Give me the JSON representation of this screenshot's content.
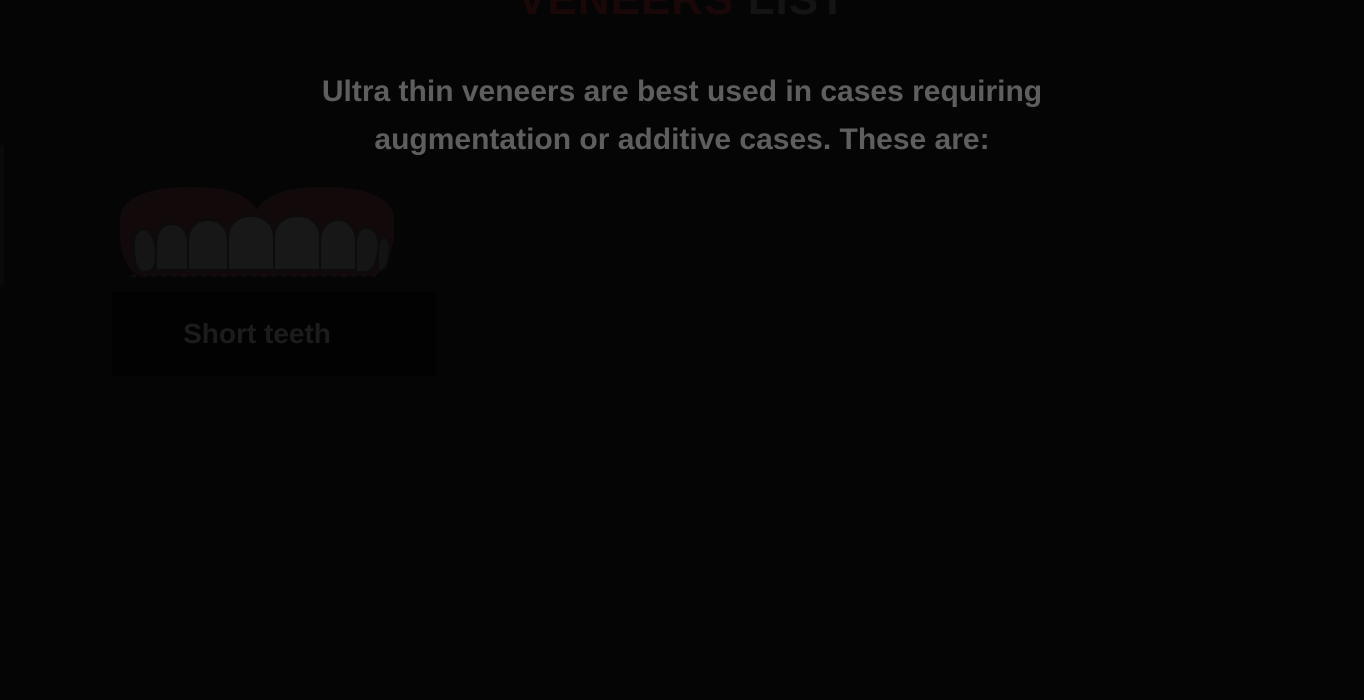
{
  "heading": {
    "accent_text": "VENEERS",
    "rest_text": "LIST"
  },
  "intro": {
    "line1": "Ultra thin veneers are best used in cases requiring",
    "line2": "augmentation or additive cases. These are:"
  },
  "cards": [
    {
      "label": "Short teeth",
      "icon": "teeth-icon"
    }
  ],
  "colors": {
    "background": "#050505",
    "intro_text": "#5e5e5e",
    "card_label_text": "#1c1c1c",
    "card_label_bg": "#020202",
    "gum": "#120a0a",
    "tooth": "#161616"
  }
}
